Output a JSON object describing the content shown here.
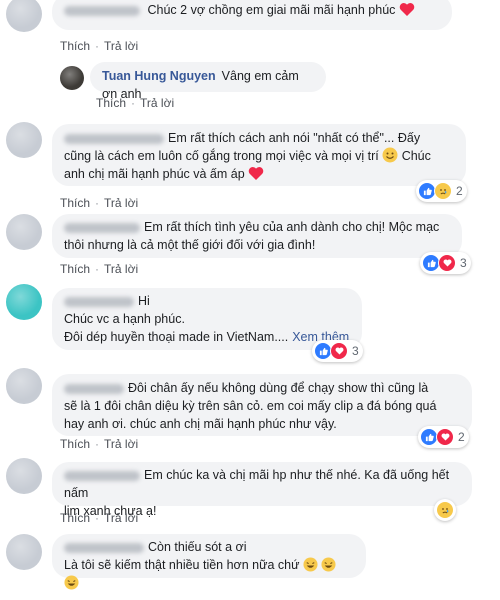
{
  "actions": {
    "like": "Thích",
    "reply": "Trả lời"
  },
  "comments": [
    {
      "text": "Chúc 2 vợ chồng em giai mãi mãi hạnh phúc"
    },
    {
      "author": "Tuan Hung Nguyen",
      "text": "Vâng em cảm ơn anh"
    },
    {
      "line1": "Em rất thích cách anh nói \"nhất có thể\"... Đấy",
      "line2": "cũng là cách em luôn cố gắng trong mọi việc và mọi vị trí",
      "line3_a": "Chúc",
      "line3_b": "anh chị mãi hạnh phúc và ấm áp",
      "react_count": "2"
    },
    {
      "line1": "Em rất thích tình yêu của anh dành cho chị! Mộc mạc",
      "line2": "thôi nhưng là cả một thế giới đối với gia đình!",
      "react_count": "3"
    },
    {
      "line1": "Hi",
      "line2": "Chúc vc a hạnh phúc.",
      "line3": "Đôi dép huyền thoại made in VietNam....",
      "more": "Xem thêm",
      "react_count": "3"
    },
    {
      "line1": "Đôi chân ấy nếu không dùng để chạy show thì cũng là",
      "line2": "sẽ là 1 đôi chân diệu kỳ trên sân cỏ. em coi mấy clip a đá bóng quá",
      "line3": "hay anh ơi. chúc anh chị mãi hạnh phúc như vậy.",
      "react_count": "2"
    },
    {
      "line1": "Em chúc ka và chị mãi hp như thế nhé. Ka đã uống hết nấm",
      "line2": "lim xanh chưa ạ!"
    },
    {
      "line1": "Còn thiếu sót a ơi",
      "line2": "Là tôi sẽ kiếm thật nhiều tiền hơn nữa chứ"
    }
  ]
}
